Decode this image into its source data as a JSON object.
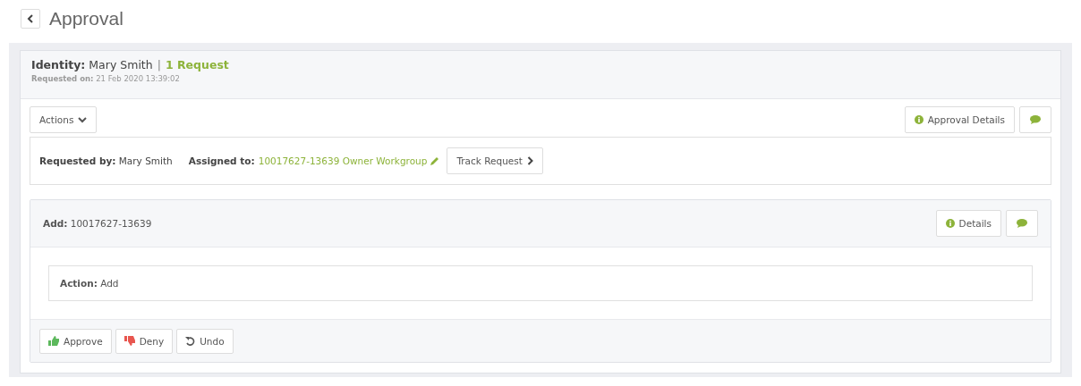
{
  "page": {
    "title": "Approval"
  },
  "header": {
    "identity": "**Identity:** Mary Smith",
    "separator": "|",
    "request_count": "1 Request",
    "requested_on": "**Requested on:** 21 Feb 2020 13:39:02"
  },
  "toolbar": {
    "actions": "Actions",
    "approval_details": "Approval Details"
  },
  "info": {
    "requested_by": "**Requested by:** Mary Smith",
    "assigned_label": "Assigned to:",
    "assigned_value": "10017627-13639 Owner Workgroup",
    "track": "Track Request"
  },
  "item": {
    "title": "**Add:** 10017627-13639",
    "details": "Details",
    "action": "**Action:** Add",
    "buttons": [
      {
        "kind": "approve",
        "label": "Approve"
      },
      {
        "kind": "deny",
        "label": "Deny"
      },
      {
        "kind": "undo",
        "label": "Undo"
      }
    ]
  }
}
